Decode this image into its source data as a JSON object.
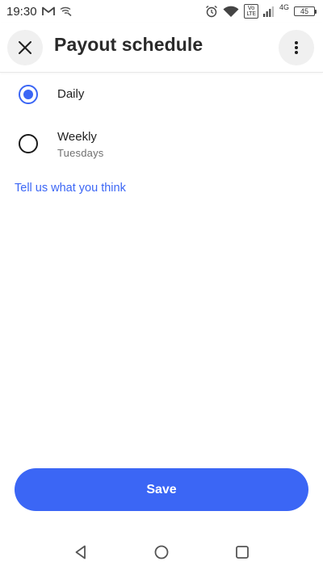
{
  "status_bar": {
    "time": "19:30",
    "icons": [
      "gmail-icon",
      "wifi-call-icon",
      "alarm-icon",
      "wifi-icon",
      "volte-icon",
      "signal-icon"
    ],
    "volte_label": "Vo\nLTE",
    "network_type": "4G",
    "battery": "45"
  },
  "app_bar": {
    "title": "Payout schedule",
    "close_icon": "close-icon",
    "more_icon": "more-vertical-icon"
  },
  "options": [
    {
      "label": "Daily",
      "sublabel": "",
      "selected": true
    },
    {
      "label": "Weekly",
      "sublabel": "Tuesdays",
      "selected": false
    }
  ],
  "feedback_link": "Tell us what you think",
  "save_button": {
    "label": "Save"
  },
  "nav_bar": {
    "icons": [
      "back-icon",
      "home-icon",
      "recent-apps-icon"
    ]
  },
  "colors": {
    "accent": "#3b66f5",
    "text": "#1f1f1f",
    "subtext": "#707070",
    "icon_button_bg": "#f0f0f0"
  }
}
